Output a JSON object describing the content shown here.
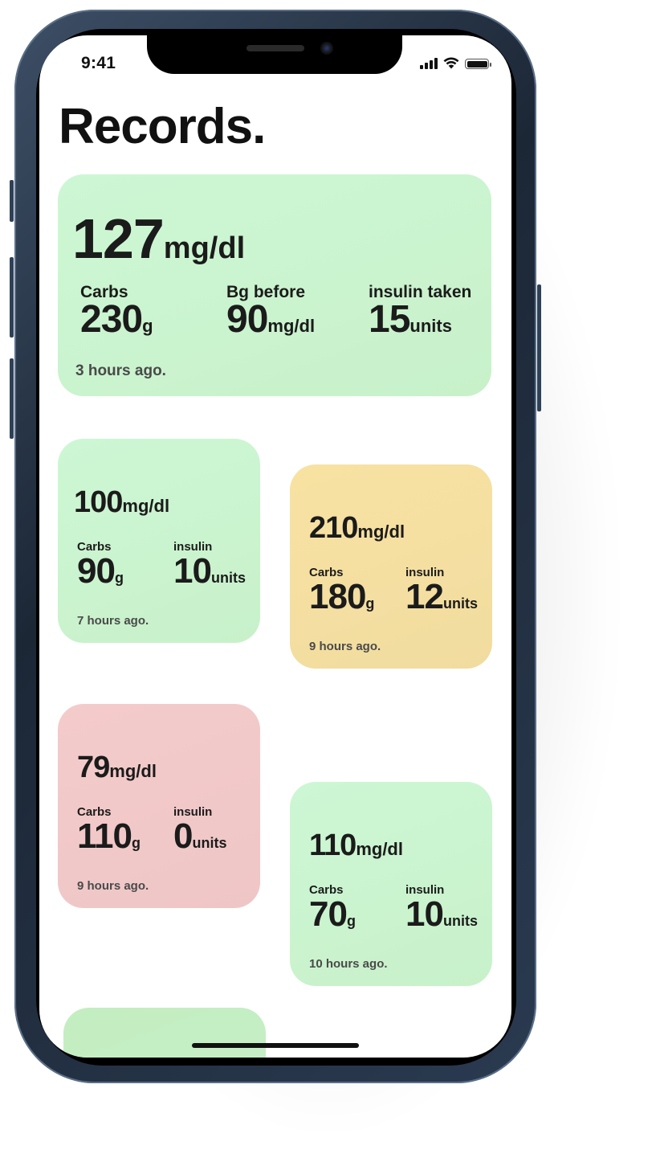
{
  "status_bar": {
    "time": "9:41"
  },
  "page": {
    "title": "Records."
  },
  "featured": {
    "value": "127",
    "unit": "mg/dl",
    "stats": [
      {
        "label": "Carbs",
        "value": "230",
        "unit": "g"
      },
      {
        "label": "Bg before",
        "value": "90",
        "unit": "mg/dl"
      },
      {
        "label": "insulin taken",
        "value": "15",
        "unit": "units"
      }
    ],
    "time_ago": "3 hours ago.",
    "color": "#cdf7d4"
  },
  "records": [
    {
      "value": "100",
      "unit": "mg/dl",
      "carbs_label": "Carbs",
      "carbs": "90",
      "carbs_unit": "g",
      "insulin_label": "insulin",
      "insulin": "10",
      "insulin_unit": "units",
      "time_ago": "7 hours ago.",
      "color": "#cdf7d4"
    },
    {
      "value": "210",
      "unit": "mg/dl",
      "carbs_label": "Carbs",
      "carbs": "180",
      "carbs_unit": "g",
      "insulin_label": "insulin",
      "insulin": "12",
      "insulin_unit": "units",
      "time_ago": "9 hours ago.",
      "color": "#f8e2a2"
    },
    {
      "value": "79",
      "unit": "mg/dl",
      "carbs_label": "Carbs",
      "carbs": "110",
      "carbs_unit": "g",
      "insulin_label": "insulin",
      "insulin": "0",
      "insulin_unit": "units",
      "time_ago": "9 hours ago.",
      "color": "#f4cbcb"
    },
    {
      "value": "110",
      "unit": "mg/dl",
      "carbs_label": "Carbs",
      "carbs": "70",
      "carbs_unit": "g",
      "insulin_label": "insulin",
      "insulin": "10",
      "insulin_unit": "units",
      "time_ago": "10 hours ago.",
      "color": "#cdf7d4"
    }
  ]
}
